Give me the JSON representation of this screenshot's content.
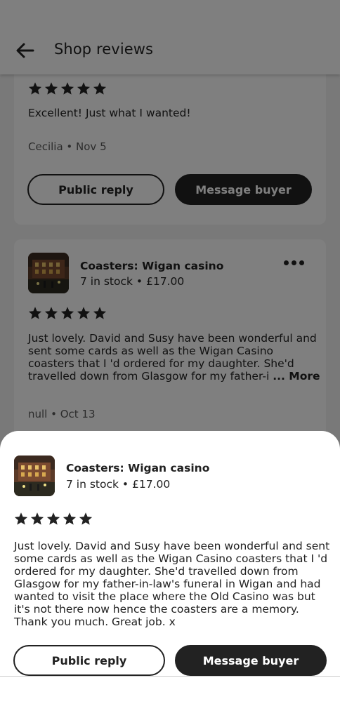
{
  "header": {
    "title": "Shop reviews",
    "back_icon": "arrow-left-icon"
  },
  "reviews": [
    {
      "rating": 5,
      "text": "Excellent! Just what I wanted!",
      "author": "Cecilia",
      "date": "Nov 5",
      "meta": "Cecilia • Nov 5",
      "public_reply_label": "Public reply",
      "message_buyer_label": "Message buyer"
    },
    {
      "listing_title": "Coasters: Wigan casino",
      "listing_sub": "7 in stock • £17.00",
      "rating": 5,
      "text_lines": [
        "Just lovely. David and Susy have been wonderful and",
        "sent some cards as well as the Wigan Casino",
        "coasters that I 'd ordered for my daughter. She'd",
        "travelled down from Glasgow for my father-i"
      ],
      "ellipsis": "...",
      "more_label": "More",
      "author": "null",
      "date": "Oct 13",
      "meta": "null • Oct 13",
      "more_icon": "more-horizontal-icon"
    }
  ],
  "sheet": {
    "listing_title": "Coasters: Wigan casino",
    "listing_sub": "7 in stock • £17.00",
    "rating": 5,
    "text_lines": [
      "Just lovely. David and Susy have been wonderful and sent",
      "some cards as well as the Wigan Casino coasters that I 'd",
      "ordered for my daughter. She'd travelled down from",
      "Glasgow for my father-in-law's funeral in Wigan and had",
      "wanted to visit the place where the Old Casino was but",
      "it's not there now hence the coasters are a memory.",
      "Thank you much. Great job. x"
    ],
    "public_reply_label": "Public reply",
    "message_buyer_label": "Message buyer"
  },
  "colors": {
    "text": "#222222",
    "muted": "#595959",
    "background": "#f2f2f2",
    "scrim": "rgba(0,0,0,0.5)"
  }
}
